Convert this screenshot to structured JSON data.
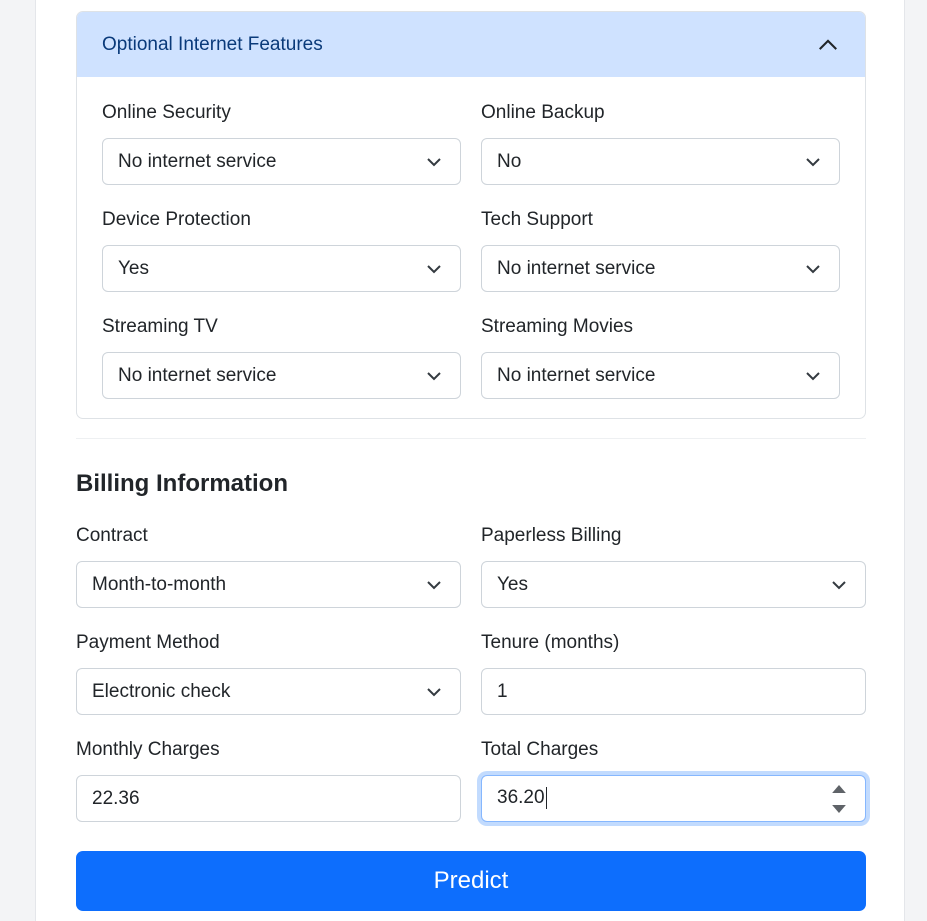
{
  "accordion": {
    "title": "Optional Internet Features",
    "fields": [
      {
        "label": "Online Security",
        "value": "No internet service"
      },
      {
        "label": "Online Backup",
        "value": "No"
      },
      {
        "label": "Device Protection",
        "value": "Yes"
      },
      {
        "label": "Tech Support",
        "value": "No internet service"
      },
      {
        "label": "Streaming TV",
        "value": "No internet service"
      },
      {
        "label": "Streaming Movies",
        "value": "No internet service"
      }
    ]
  },
  "billing": {
    "title": "Billing Information",
    "contract": {
      "label": "Contract",
      "value": "Month-to-month"
    },
    "paperless": {
      "label": "Paperless Billing",
      "value": "Yes"
    },
    "payment": {
      "label": "Payment Method",
      "value": "Electronic check"
    },
    "tenure": {
      "label": "Tenure (months)",
      "value": "1"
    },
    "monthly": {
      "label": "Monthly Charges",
      "value": "22.36"
    },
    "total": {
      "label": "Total Charges",
      "value": "36.20"
    }
  },
  "predict_label": "Predict",
  "colors": {
    "accent": "#0d6efd",
    "accordion_header": "#cfe2ff"
  }
}
